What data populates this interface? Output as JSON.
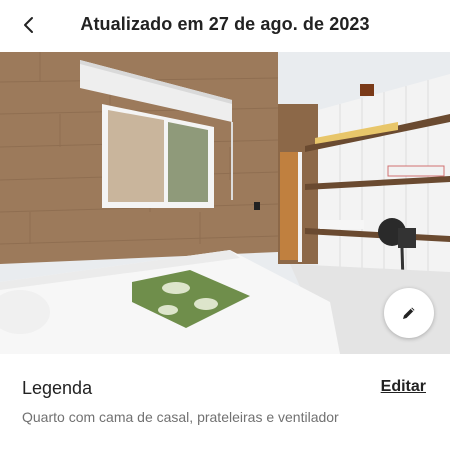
{
  "header": {
    "title": "Atualizado em 27 de ago. de 2023",
    "back_icon": "chevron-left-icon"
  },
  "photo": {
    "subject": "bedroom-photo"
  },
  "edit_fab": {
    "icon": "pencil-icon"
  },
  "caption": {
    "heading": "Legenda",
    "edit_label": "Editar",
    "text": "Quarto com cama de casal, prateleiras e ventilador"
  }
}
